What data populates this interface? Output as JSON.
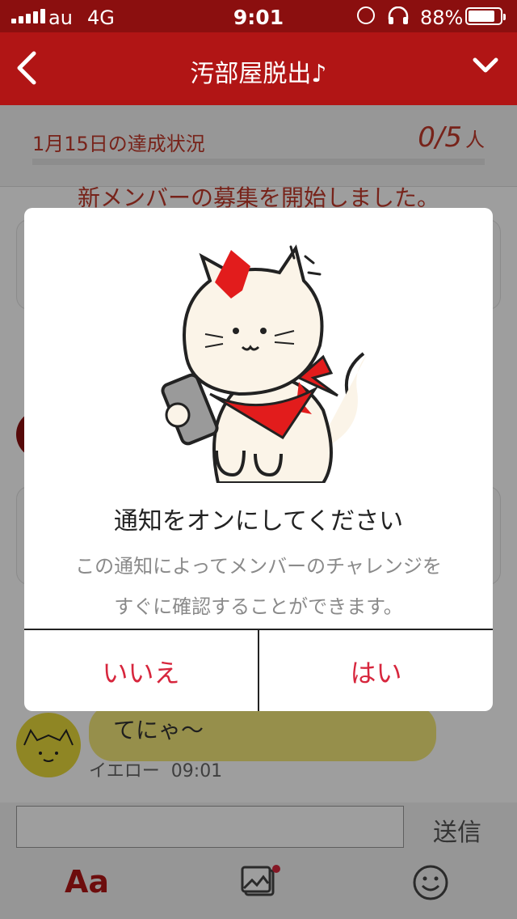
{
  "status_bar": {
    "carrier": "au",
    "network": "4G",
    "time": "9:01",
    "battery_percent": "88%",
    "battery_level": 0.88,
    "icons": [
      "signal-icon",
      "rotation-lock-icon",
      "headphones-icon",
      "battery-icon"
    ]
  },
  "header": {
    "title": "汚部屋脱出♪",
    "back_icon": "chevron-left-icon",
    "menu_icon": "chevron-down-icon"
  },
  "progress": {
    "label": "1月15日の達成状況",
    "count": "0/5",
    "unit": "人",
    "achieved": 0,
    "total": 5
  },
  "chat": {
    "system_message": "新メンバーの募集を開始しました。",
    "message_text": "てにゃ〜",
    "sender": "イエロー",
    "time": "09:01"
  },
  "composer": {
    "input_placeholder": "",
    "send_label": "送信",
    "text_tool_label": "Aa",
    "image_icon": "image-icon",
    "sticker_icon": "smile-icon"
  },
  "dialog": {
    "title": "通知をオンにしてください",
    "description_line1": "この通知によってメンバーのチャレンジを",
    "description_line2": "すぐに確認することができます。",
    "no_label": "いいえ",
    "yes_label": "はい",
    "illustration": "cat-with-phone-illustration"
  },
  "colors": {
    "header_red": "#b11515",
    "status_red": "#8b0f0f",
    "accent_red": "#d7263d",
    "bubble_yellow": "#f3e77a"
  }
}
